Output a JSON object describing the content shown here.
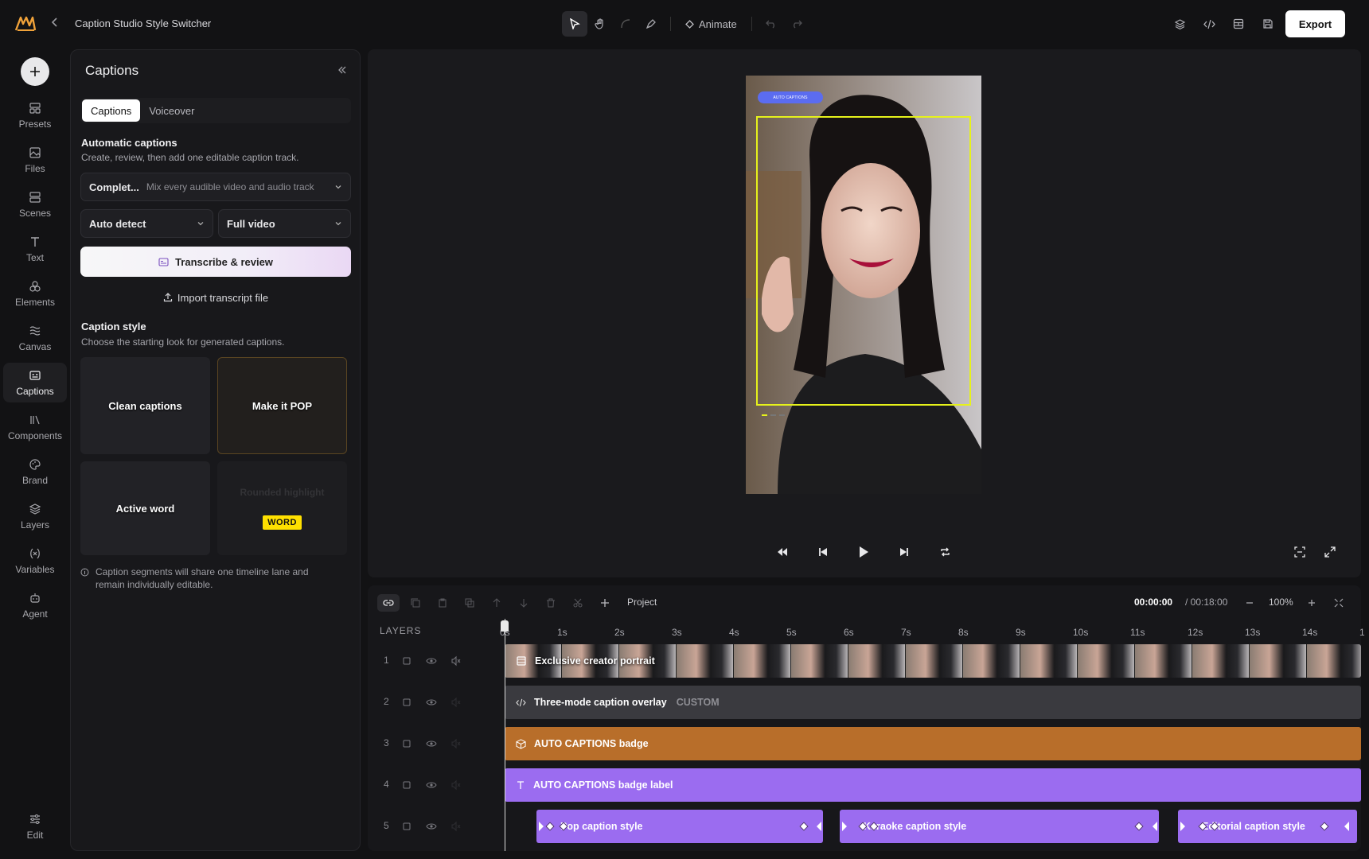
{
  "app": {
    "title": "Caption Studio Style Switcher"
  },
  "toolbar": {
    "animate_label": "Animate",
    "export_label": "Export"
  },
  "rail": {
    "items": [
      {
        "label": "Presets"
      },
      {
        "label": "Files"
      },
      {
        "label": "Scenes"
      },
      {
        "label": "Text"
      },
      {
        "label": "Elements"
      },
      {
        "label": "Canvas"
      },
      {
        "label": "Captions"
      },
      {
        "label": "Components"
      },
      {
        "label": "Brand"
      },
      {
        "label": "Layers"
      },
      {
        "label": "Variables"
      },
      {
        "label": "Agent"
      }
    ],
    "edit_label": "Edit",
    "active": "Captions"
  },
  "panel": {
    "title": "Captions",
    "tabs": [
      {
        "label": "Captions"
      },
      {
        "label": "Voiceover"
      }
    ],
    "auto": {
      "heading": "Automatic captions",
      "description": "Create, review, then add one editable caption track.",
      "mode_value": "Complet...",
      "mode_hint": "Mix every audible video and audio track",
      "language_value": "Auto detect",
      "range_value": "Full video",
      "transcribe_label": "Transcribe & review",
      "import_label": "Import transcript file"
    },
    "style": {
      "heading": "Caption style",
      "description": "Choose the starting look for generated captions.",
      "cards": [
        {
          "label": "Clean captions"
        },
        {
          "label": "Make it POP"
        },
        {
          "label": "Active word"
        },
        {
          "label": "Rounded highlight",
          "word": "WORD"
        }
      ]
    },
    "note": "Caption segments will share one timeline lane and remain individually editable."
  },
  "preview": {
    "badge_text": "AUTO CAPTIONS"
  },
  "timeline": {
    "project_label": "Project",
    "current_time": "00:00:00",
    "duration": "/ 00:18:00",
    "zoom": "100%",
    "layers_heading": "LAYERS",
    "ticks": [
      "0s",
      "1s",
      "2s",
      "3s",
      "4s",
      "5s",
      "6s",
      "7s",
      "8s",
      "9s",
      "10s",
      "11s",
      "12s",
      "13s",
      "14s",
      "1"
    ],
    "tracks": [
      {
        "num": "1",
        "label": "Exclusive creator portrait"
      },
      {
        "num": "2",
        "label": "Three-mode caption overlay",
        "tag": "CUSTOM"
      },
      {
        "num": "3",
        "label": "AUTO CAPTIONS badge"
      },
      {
        "num": "4",
        "label": "AUTO CAPTIONS badge label"
      },
      {
        "num": "5",
        "clips": [
          "Pop caption style",
          "Karaoke caption style",
          "Editorial caption style"
        ]
      }
    ]
  },
  "colors": {
    "accent_orange": "#b86e2a",
    "accent_purple": "#9b6cf0",
    "selection_yellow": "#e6f21b",
    "badge_blue": "#5b6cf0"
  }
}
